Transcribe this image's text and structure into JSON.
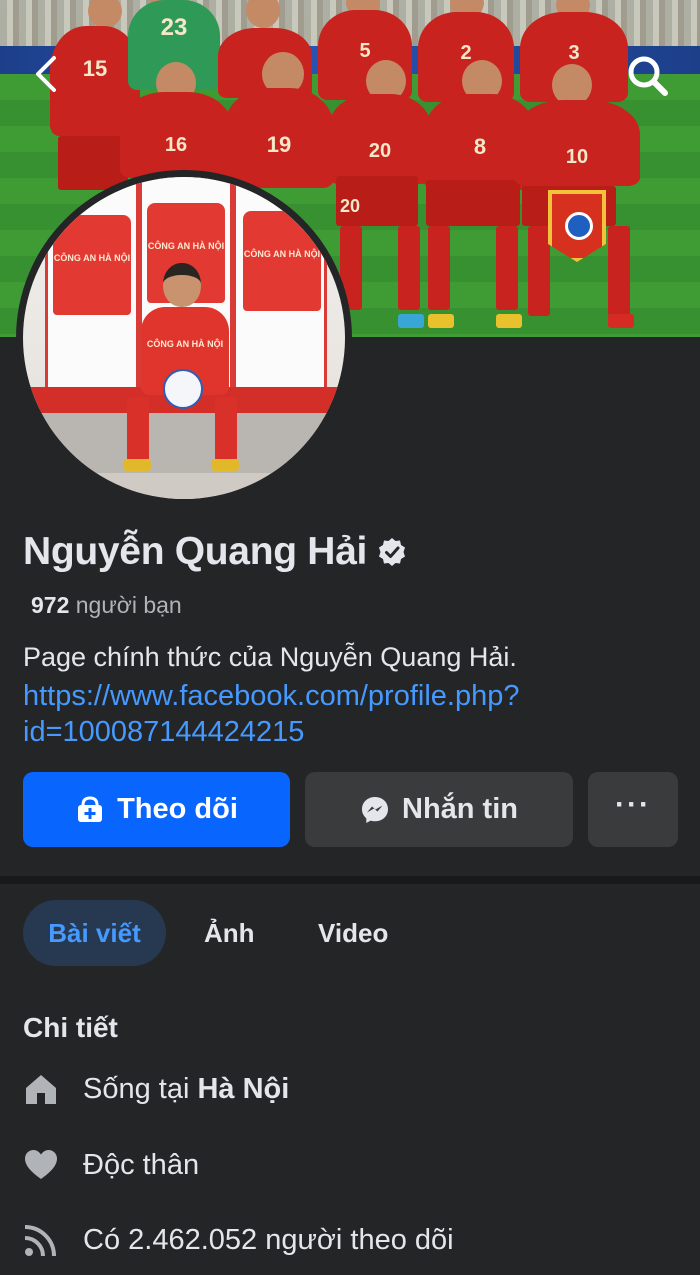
{
  "profile": {
    "name": "Nguyễn Quang Hải",
    "friends_count": "972",
    "friends_label": "người bạn",
    "bio": "Page chính thức của Nguyễn Quang Hải.",
    "link": "https://www.facebook.com/profile.php?id=100087144424215"
  },
  "cover": {
    "jersey_numbers": [
      "15",
      "23",
      "2",
      "5",
      "2",
      "3",
      "16",
      "19",
      "20",
      "8",
      "10",
      "15",
      "20",
      "8"
    ]
  },
  "avatar": {
    "jersey_text": "CÔNG AN HÀ NỘI"
  },
  "actions": {
    "follow_label": "Theo dõi",
    "message_label": "Nhắn tin",
    "more_label": "···"
  },
  "tabs": [
    {
      "label": "Bài viết",
      "active": true
    },
    {
      "label": "Ảnh",
      "active": false
    },
    {
      "label": "Video",
      "active": false
    }
  ],
  "details": {
    "title": "Chi tiết",
    "lives_prefix": "Sống tại",
    "lives_city": "Hà Nội",
    "relationship": "Độc thân",
    "followers": "Có 2.462.052 người theo dõi"
  },
  "colors": {
    "background": "#242526",
    "primary_blue": "#0866ff",
    "link_blue": "#4599ff",
    "secondary_button": "#3a3b3c",
    "active_tab_bg": "#263951"
  },
  "icons": {
    "back": "chevron-left-icon",
    "search": "search-icon",
    "verified": "verified-badge-icon",
    "follow": "follow-icon",
    "message": "messenger-icon",
    "home": "home-icon",
    "heart": "heart-icon",
    "rss": "rss-icon"
  }
}
